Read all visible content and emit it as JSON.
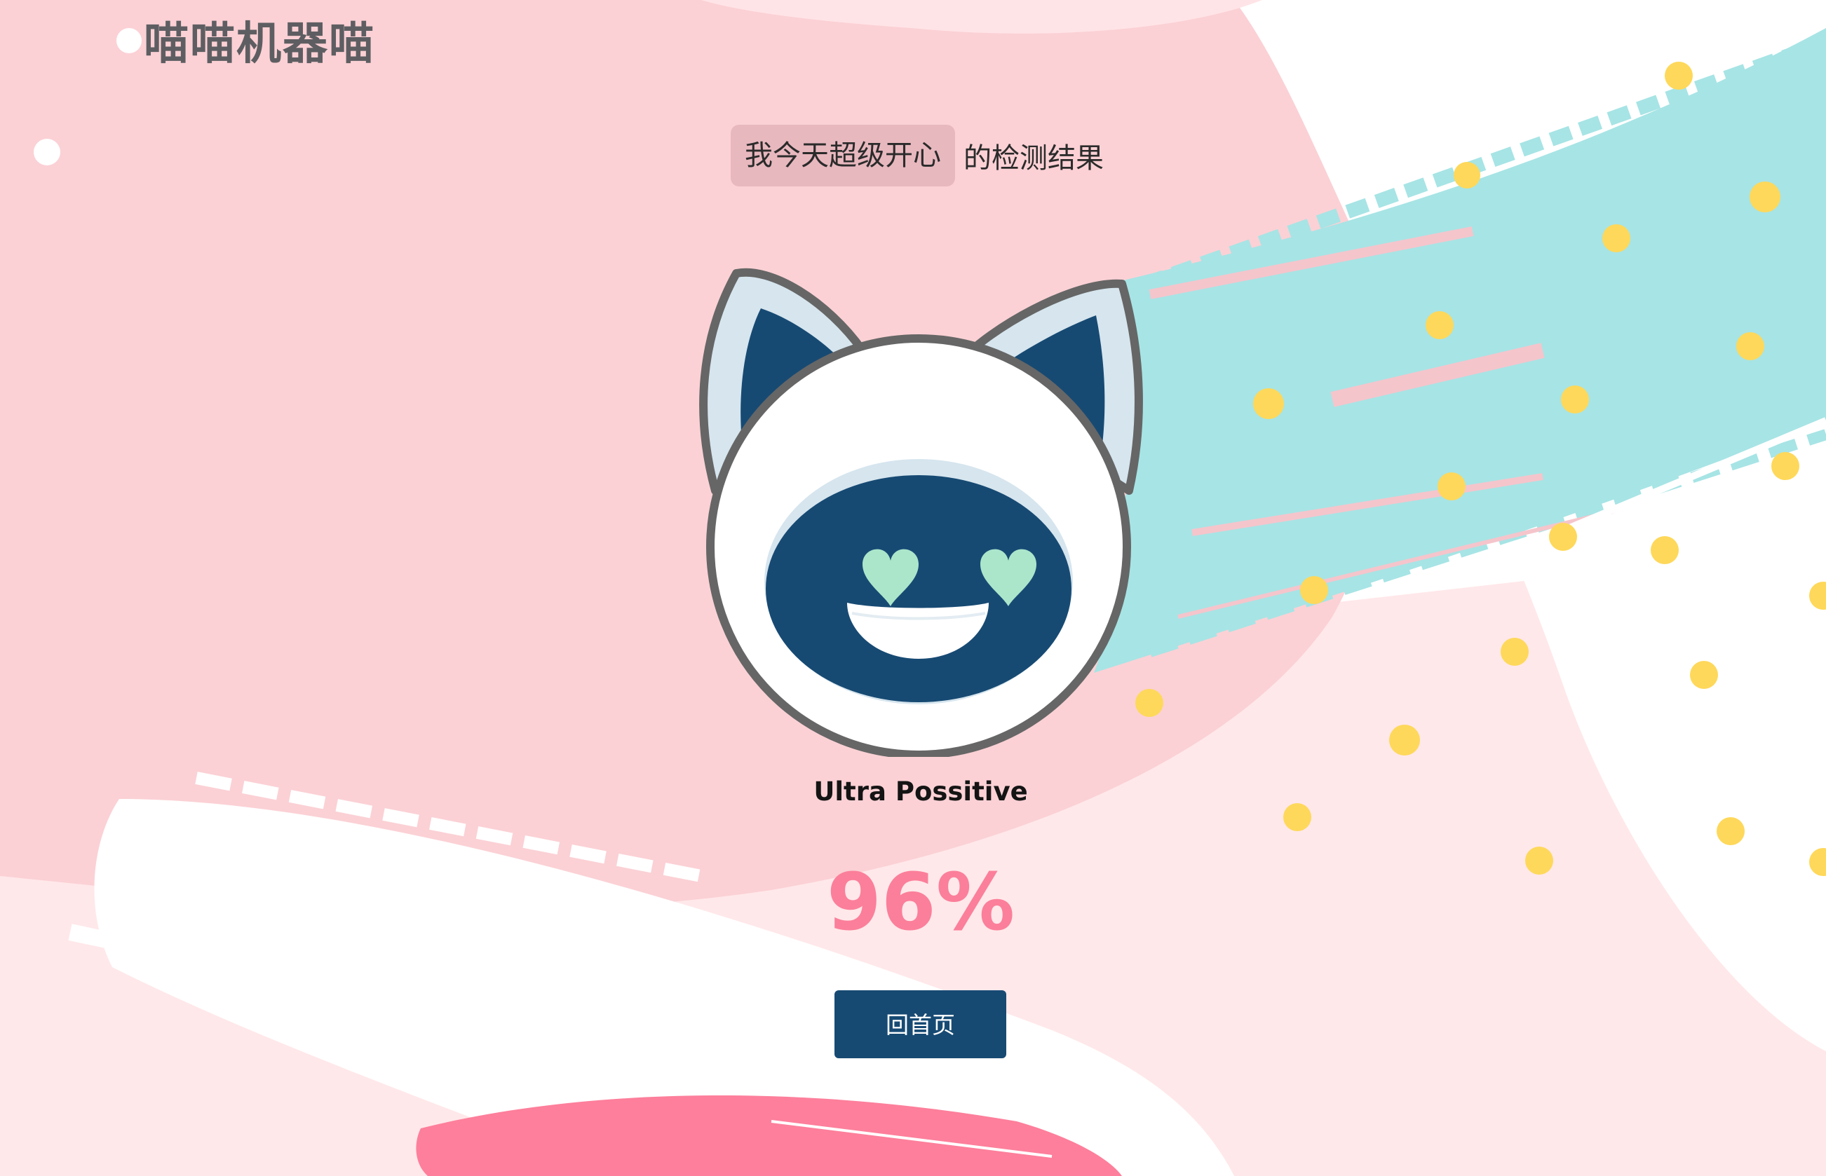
{
  "app": {
    "logo_text": "喵喵机器喵"
  },
  "result": {
    "mood": "我今天超级开心",
    "suffix": "的检测结果"
  },
  "robot": {
    "expression": "heart-eyes-smile",
    "colors": {
      "outline": "#666666",
      "face": "#ffffff",
      "visor": "#174a73",
      "ear_inner": "#d6e5ee",
      "hearts": "#abe6cb"
    }
  },
  "sentiment": {
    "label": "Ultra Possitive",
    "score": "96%"
  },
  "actions": {
    "home_button": "回首页"
  },
  "theme": {
    "pink_background": "#fbd1d5",
    "light_pink": "#ffe8ea",
    "teal_brush": "#a7e4e5",
    "hot_pink": "#fd7f9b",
    "yellow_dots": "#fed85a",
    "button": "#174a73"
  }
}
